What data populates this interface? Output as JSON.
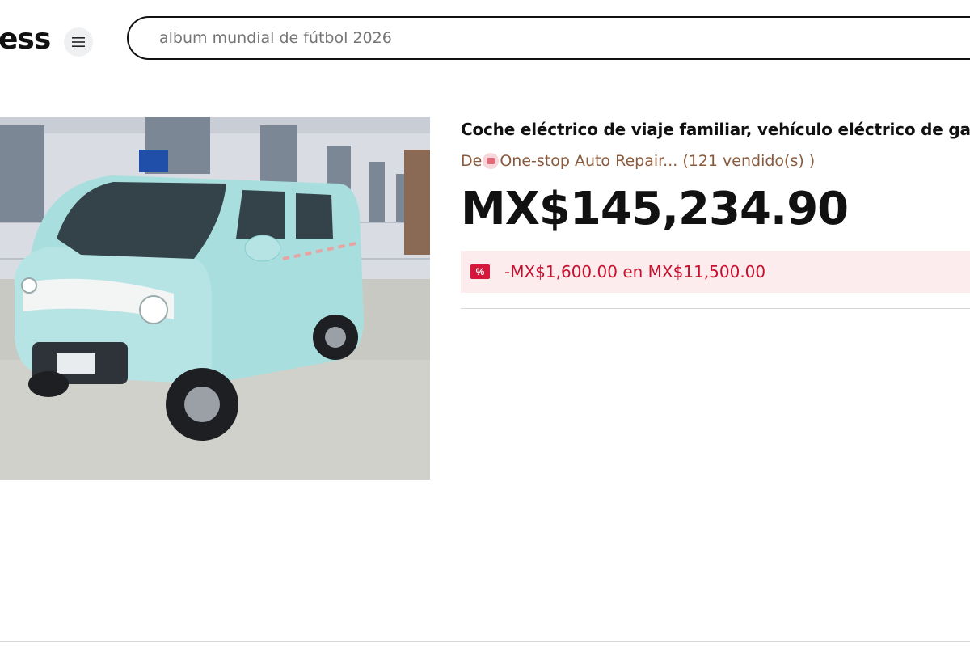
{
  "header": {
    "logo_text": "ess",
    "menu_icon": "hamburger-menu-icon",
    "search": {
      "placeholder": "album mundial de fútbol 2026"
    }
  },
  "product": {
    "title": "Coche eléctrico de viaje familiar, vehículo eléctrico de gara",
    "store_prefix": "De",
    "store_name": "One-stop Auto Repair...",
    "sold_count": "(121 vendido(s) )",
    "price": "MX$145,234.90",
    "coupon": {
      "icon": "%",
      "text": "-MX$1,600.00 en MX$11,500.00"
    }
  },
  "colors": {
    "accent": "#c8102e",
    "store_link": "#8a5a3c",
    "coupon_bg": "#fdecee"
  }
}
